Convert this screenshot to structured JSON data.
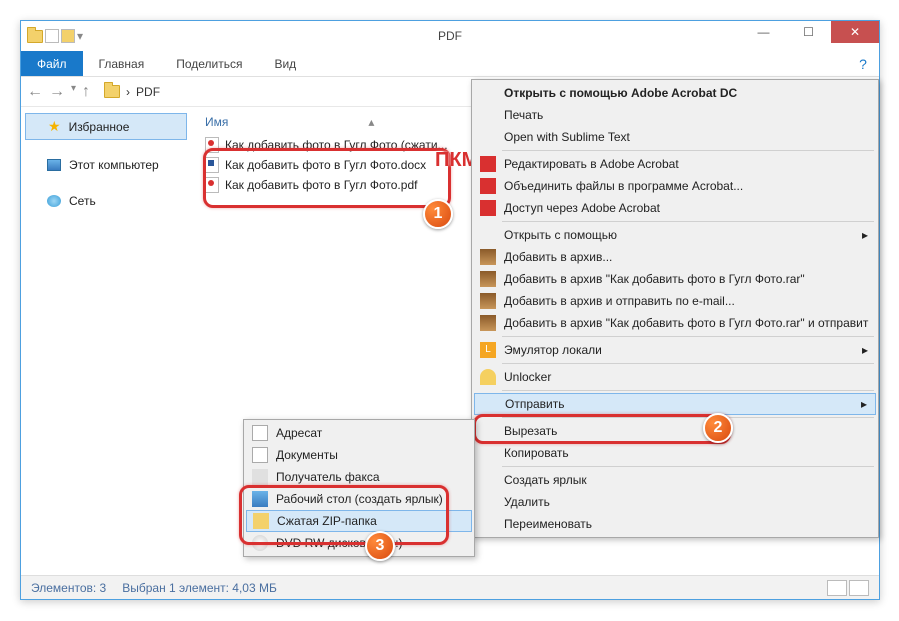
{
  "title": "PDF",
  "ribbon": {
    "file": "Файл",
    "home": "Главная",
    "share": "Поделиться",
    "view": "Вид"
  },
  "breadcrumb": "PDF",
  "sidebar": {
    "favorites": "Избранное",
    "computer": "Этот компьютер",
    "network": "Сеть"
  },
  "columns": {
    "name": "Имя"
  },
  "files": [
    "Как добавить фото в Гугл Фото (сжати...",
    "Как добавить фото в Гугл Фото.docx",
    "Как добавить фото в Гугл Фото.pdf"
  ],
  "statusbar": {
    "count": "Элементов: 3",
    "selection": "Выбран 1 элемент: 4,03 МБ"
  },
  "annotations": {
    "pkm": "ПКМ"
  },
  "context_main": {
    "open_with_acrobat": "Открыть с помощью Adobe Acrobat DC",
    "print": "Печать",
    "open_sublime": "Open with Sublime Text",
    "edit_acrobat": "Редактировать в Adobe Acrobat",
    "combine_acrobat": "Объединить файлы в программе Acrobat...",
    "access_acrobat": "Доступ через Adobe Acrobat",
    "open_with": "Открыть с помощью",
    "add_archive": "Добавить в архив...",
    "add_rar": "Добавить в архив \"Как добавить фото в Гугл Фото.rar\"",
    "add_email": "Добавить в архив и отправить по e-mail...",
    "add_rar_send": "Добавить в архив \"Как добавить фото в Гугл Фото.rar\" и отправит",
    "locale_emu": "Эмулятор локали",
    "unlocker": "Unlocker",
    "send_to": "Отправить",
    "cut": "Вырезать",
    "copy": "Копировать",
    "create_shortcut": "Создать ярлык",
    "delete": "Удалить",
    "rename": "Переименовать"
  },
  "context_sendto": {
    "addressee": "Адресат",
    "documents": "Документы",
    "fax": "Получатель факса",
    "desktop": "Рабочий стол (создать ярлык)",
    "zip": "Сжатая ZIP-папка",
    "dvd": "DVD RW дисковод (D:)"
  }
}
